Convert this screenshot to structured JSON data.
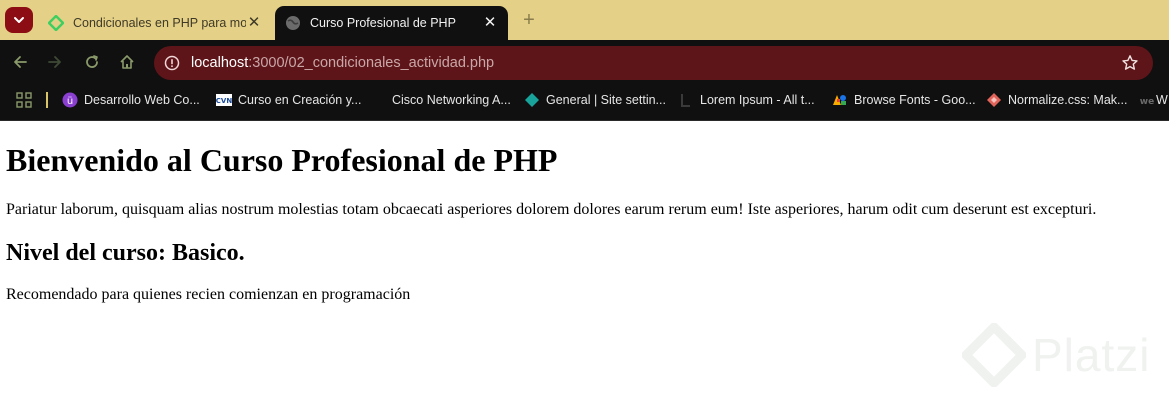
{
  "browser": {
    "tabs": [
      {
        "title": "Condicionales en PHP para mo",
        "favicon": "platzi-icon",
        "active": false
      },
      {
        "title": "Curso Profesional de PHP",
        "favicon": "globe-icon",
        "active": true
      }
    ],
    "omnibox": {
      "host": "localhost",
      "path": ":3000/02_condicionales_actividad.php"
    },
    "bookmarks": [
      {
        "label": "Desarrollo Web Co...",
        "icon": "purple-badge-icon"
      },
      {
        "label": "Curso en Creación y...",
        "icon": "cisco-logo-icon"
      },
      {
        "label": "Cisco Networking A...",
        "icon": "blank-icon"
      },
      {
        "label": "General | Site settin...",
        "icon": "teal-diamond-icon"
      },
      {
        "label": "Lorem Ipsum - All t...",
        "icon": "lorem-icon"
      },
      {
        "label": "Browse Fonts - Goo...",
        "icon": "google-fonts-icon"
      },
      {
        "label": "Normalize.css: Mak...",
        "icon": "red-diamond-icon"
      },
      {
        "label": "W",
        "icon": "we-icon"
      }
    ],
    "colors": {
      "tabstrip": "#e4d086",
      "toolbar": "#101010",
      "omnibox": "#5e1519",
      "accent": "#8c0d14"
    }
  },
  "page": {
    "heading": "Bienvenido al Curso Profesional de PHP",
    "paragraph": "Pariatur laborum, quisquam alias nostrum molestias totam obcaecati asperiores dolorem dolores earum rerum eum! Iste asperiores, harum odit cum deserunt est excepturi.",
    "level_heading": "Nivel del curso: Basico.",
    "recommendation": "Recomendado para quienes recien comienzan en programación"
  },
  "watermark": {
    "text": "Platzi"
  }
}
